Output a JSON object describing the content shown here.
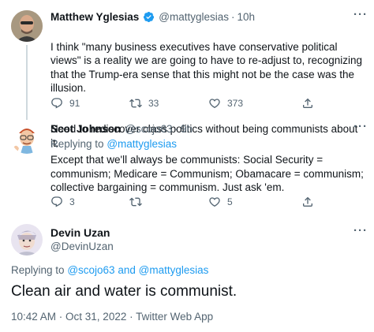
{
  "tweet1": {
    "name": "Matthew Yglesias",
    "handle": "@mattyglesias",
    "separator": "·",
    "time": "10h",
    "text_p1": "I think \"many business executives have conservative political views\" is a reality we are going to have to re-adjust to, recognizing that the Trump-era sense that this might not be the case was the illusion.",
    "text_p2": "Need to rediscover class politics without being communists about it.",
    "replies": "91",
    "retweets": "33",
    "likes": "373"
  },
  "tweet2": {
    "name": "Scot Johnson",
    "handle": "@scojo63",
    "separator": "·",
    "time": "9h",
    "replying_prefix": "Replying to",
    "replying_handle": "@mattyglesias",
    "text": "Except that we'll always be communists: Social Security = communism; Medicare = Communism; Obamacare = communism; collective bargaining = communism.  Just ask 'em.",
    "replies": "3",
    "retweets": "",
    "likes": "5"
  },
  "tweet3": {
    "name": "Devin Uzan",
    "handle": "@DevinUzan",
    "replying_prefix": "Replying to",
    "replying_handle1": "@scojo63",
    "replying_and": "and",
    "replying_handle2": "@mattyglesias",
    "text": "Clean air and water is communist.",
    "timestamp": "10:42 AM · Oct 31, 2022 · Twitter Web App"
  },
  "colors": {
    "link": "#1d9bf0",
    "secondary_text": "#536471",
    "verified": "#1d9bf0"
  },
  "icons": [
    "reply-icon",
    "retweet-icon",
    "like-icon",
    "share-icon",
    "verified-badge-icon",
    "more-icon"
  ]
}
